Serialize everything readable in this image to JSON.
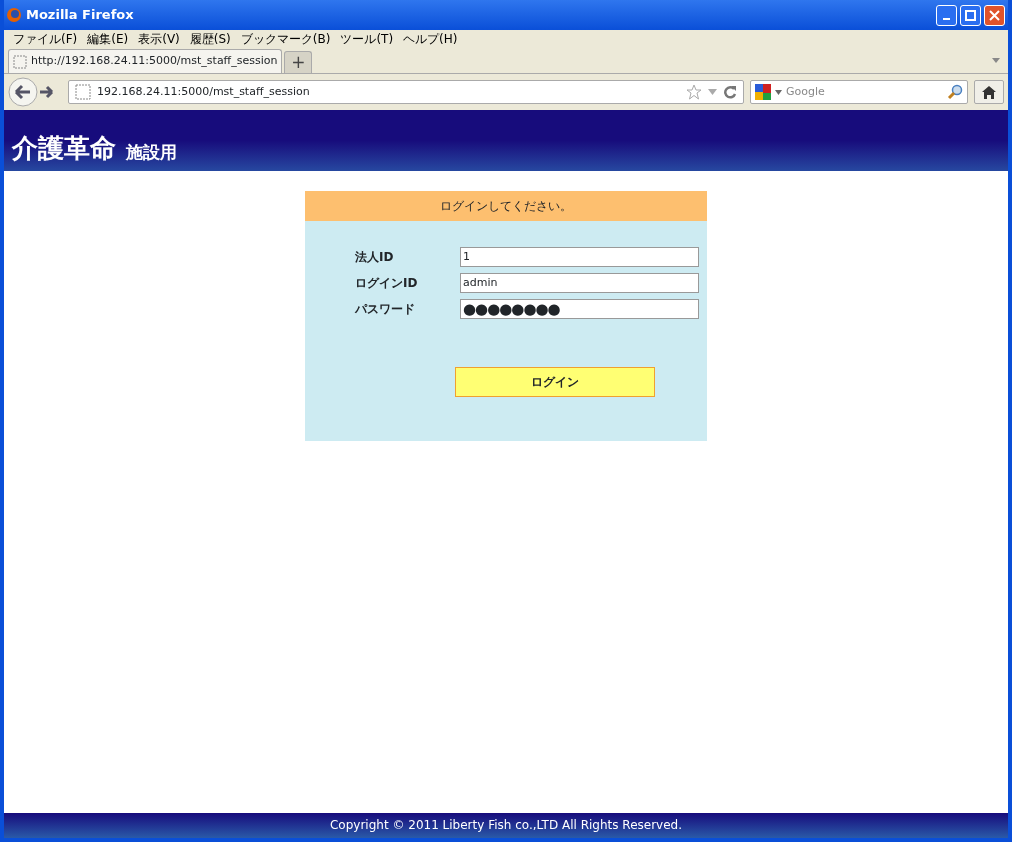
{
  "window": {
    "title": "Mozilla Firefox"
  },
  "menu": [
    "ファイル(F)",
    "編集(E)",
    "表示(V)",
    "履歴(S)",
    "ブックマーク(B)",
    "ツール(T)",
    "ヘルプ(H)"
  ],
  "tabs": [
    {
      "label": "http://192.168.24.11:5000/mst_staff_session",
      "selected": true
    }
  ],
  "new_tab": "+",
  "address": "192.168.24.11:5000/mst_staff_session",
  "search": {
    "placeholder": "Google"
  },
  "header": {
    "title": "介護革命",
    "subtitle": "施設用"
  },
  "login": {
    "message": "ログインしてください。",
    "fields": [
      {
        "label": "法人ID",
        "value": "1",
        "kind": "text"
      },
      {
        "label": "ログインID",
        "value": "admin",
        "kind": "text"
      },
      {
        "label": "パスワード",
        "value": "●●●●●●●●",
        "kind": "password"
      }
    ],
    "button": "ログイン"
  },
  "footer": "Copyright © 2011 Liberty Fish co.,LTD All Rights Reserved."
}
